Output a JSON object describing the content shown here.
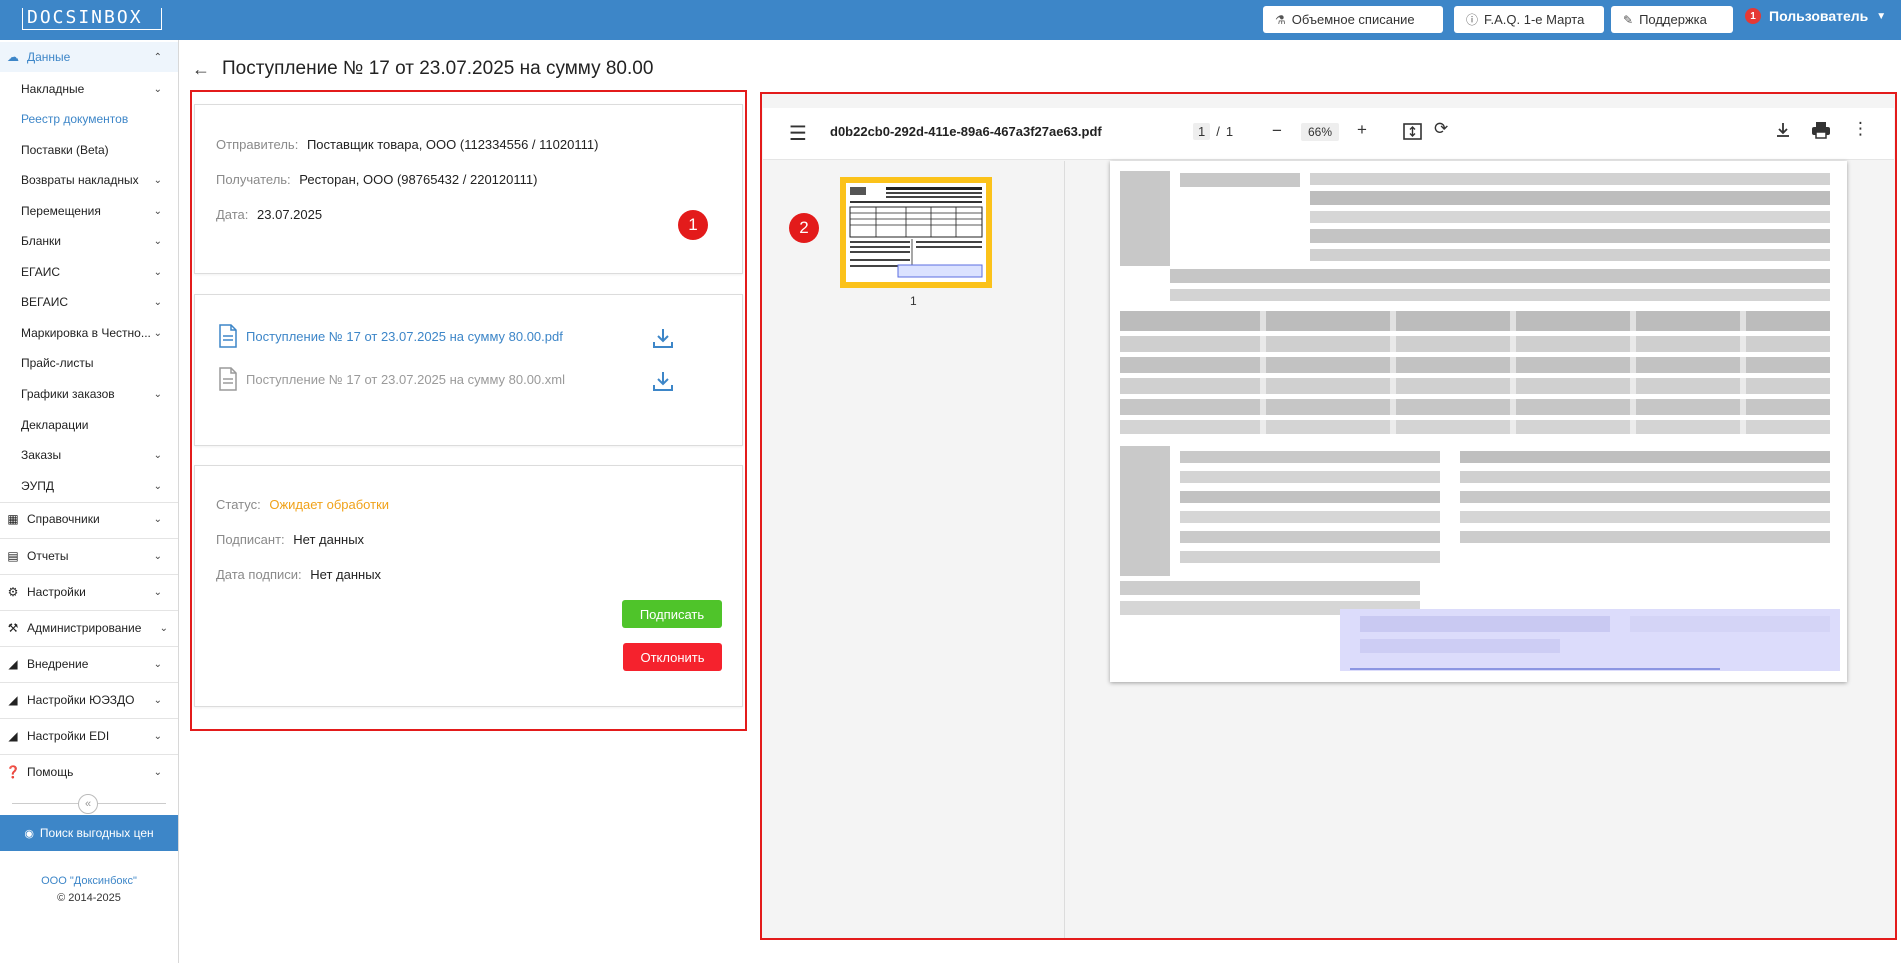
{
  "header": {
    "logo": "DOCSINBOX",
    "buttons": [
      {
        "label": "Объемное списание",
        "icon": "flask-icon"
      },
      {
        "label": "F.A.Q. 1-е Марта",
        "icon": "info-icon"
      },
      {
        "label": "Поддержка",
        "icon": "support-icon"
      }
    ],
    "notification_count": "1",
    "user": "Пользователь"
  },
  "sidebar": {
    "data_group": "Данные",
    "items": [
      {
        "label": "Накладные",
        "chevron": true
      },
      {
        "label": "Реестр документов",
        "selected": true
      },
      {
        "label": "Поставки (Beta)"
      },
      {
        "label": "Возвраты накладных",
        "chevron": true
      },
      {
        "label": "Перемещения",
        "chevron": true
      },
      {
        "label": "Бланки",
        "chevron": true
      },
      {
        "label": "ЕГАИС",
        "chevron": true
      },
      {
        "label": "ВЕГАИС",
        "chevron": true
      },
      {
        "label": "Маркировка в Честно...",
        "chevron": true
      },
      {
        "label": "Прайс-листы"
      },
      {
        "label": "Графики заказов",
        "chevron": true
      },
      {
        "label": "Декларации"
      },
      {
        "label": "Заказы",
        "chevron": true
      },
      {
        "label": "ЭУПД",
        "chevron": true
      }
    ],
    "groups": [
      {
        "label": "Справочники",
        "icon": "table-icon"
      },
      {
        "label": "Отчеты",
        "icon": "chart-icon"
      },
      {
        "label": "Настройки",
        "icon": "gear-icon"
      },
      {
        "label": "Администрирование",
        "icon": "wrench-icon"
      },
      {
        "label": "Внедрение",
        "icon": "hierarchy-icon"
      },
      {
        "label": "Настройки ЮЭЗДО",
        "icon": "hierarchy-icon"
      },
      {
        "label": "Настройки EDI",
        "icon": "hierarchy-icon"
      },
      {
        "label": "Помощь",
        "icon": "help-icon"
      }
    ],
    "search_prices": "Поиск выгодных цен",
    "company": "ООО \"Доксинбокс\"",
    "copyright": "© 2014-2025"
  },
  "page": {
    "title": "Поступление № 17 от 23.07.2025 на сумму 80.00"
  },
  "info": {
    "sender_label": "Отправитель:",
    "sender": "Поставщик товара, ООО (112334556 / 11020111)",
    "receiver_label": "Получатель:",
    "receiver": "Ресторан, ООО (98765432 / 220120111)",
    "date_label": "Дата:",
    "date": "23.07.2025"
  },
  "files": [
    {
      "name": "Поступление № 17 от 23.07.2025 на сумму 80.00.pdf"
    },
    {
      "name": "Поступление № 17 от 23.07.2025 на сумму 80.00.xml"
    }
  ],
  "status": {
    "status_label": "Статус:",
    "status": "Ожидает обработки",
    "signer_label": "Подписант:",
    "signer": "Нет данных",
    "sign_date_label": "Дата подписи:",
    "sign_date": "Нет данных",
    "sign_button": "Подписать",
    "reject_button": "Отклонить"
  },
  "markers": [
    "1",
    "2"
  ],
  "viewer": {
    "filename": "d0b22cb0-292d-411e-89a6-467a3f27ae63.pdf",
    "current_page": "1",
    "separator": "/",
    "total_pages": "1",
    "zoom": "66%",
    "thumb_label": "1"
  },
  "colors": {
    "brand": "#3d86c8",
    "marker": "#e31b1b",
    "status_pending": "#f0a21a",
    "sign": "#4fc42a",
    "reject": "#f5222d"
  }
}
